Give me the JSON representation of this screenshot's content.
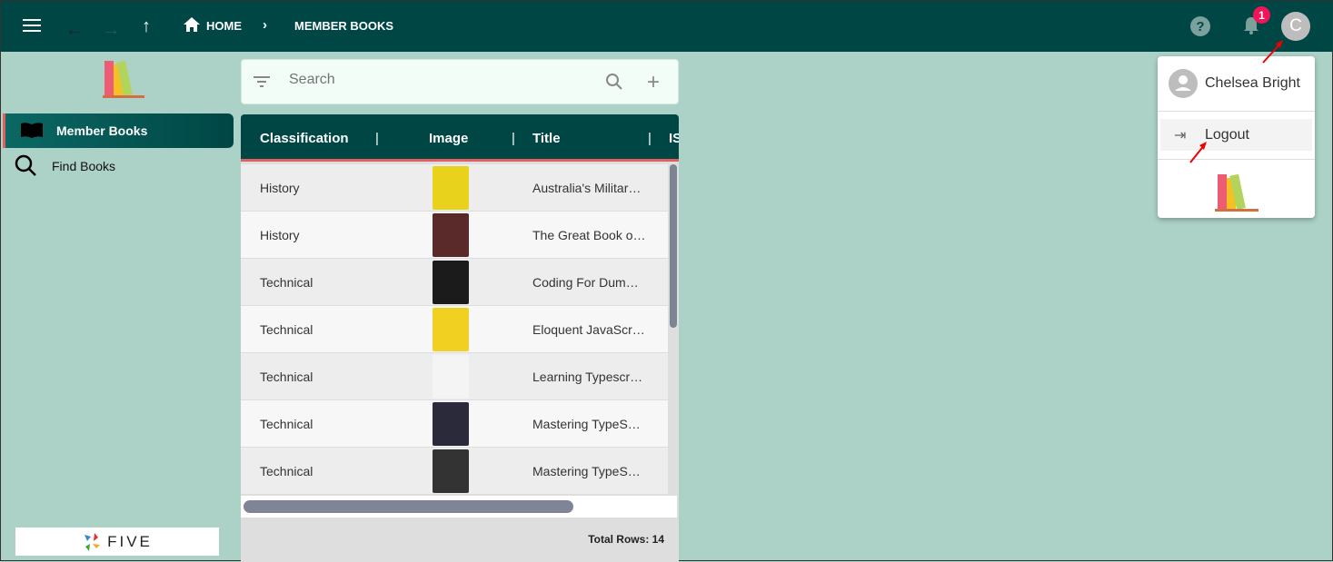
{
  "header": {
    "breadcrumb": [
      {
        "label": "HOME"
      },
      {
        "label": "MEMBER BOOKS"
      }
    ],
    "notification_count": "1",
    "avatar_initial": "C"
  },
  "sidebar": {
    "items": [
      {
        "label": "Member Books",
        "icon": "book-open-icon",
        "active": true
      },
      {
        "label": "Find Books",
        "icon": "search-icon"
      }
    ],
    "footer_logo": "FIVE"
  },
  "search": {
    "placeholder": "Search"
  },
  "grid": {
    "columns": [
      "Classification",
      "Image",
      "Title",
      "IS"
    ],
    "rows": [
      {
        "classification": "History",
        "title": "Australia's Militar…",
        "cover": "#e8d21c"
      },
      {
        "classification": "History",
        "title": "The Great Book o…",
        "cover": "#5a2a2a"
      },
      {
        "classification": "Technical",
        "title": "Coding For Dum…",
        "cover": "#1b1b1b"
      },
      {
        "classification": "Technical",
        "title": "Eloquent JavaScr…",
        "cover": "#f2d022"
      },
      {
        "classification": "Technical",
        "title": "Learning Typescr…",
        "cover": "#f4f4f4"
      },
      {
        "classification": "Technical",
        "title": "Mastering TypeS…",
        "cover": "#2a2a3a"
      },
      {
        "classification": "Technical",
        "title": "Mastering TypeS…",
        "cover": "#333333"
      }
    ],
    "total_rows": "Total Rows: 14"
  },
  "user_menu": {
    "name": "Chelsea Bright",
    "logout": "Logout"
  },
  "colors": {
    "header": "#004645",
    "background": "#acd1c6",
    "accent": "#e06060",
    "badge": "#f0145a"
  }
}
